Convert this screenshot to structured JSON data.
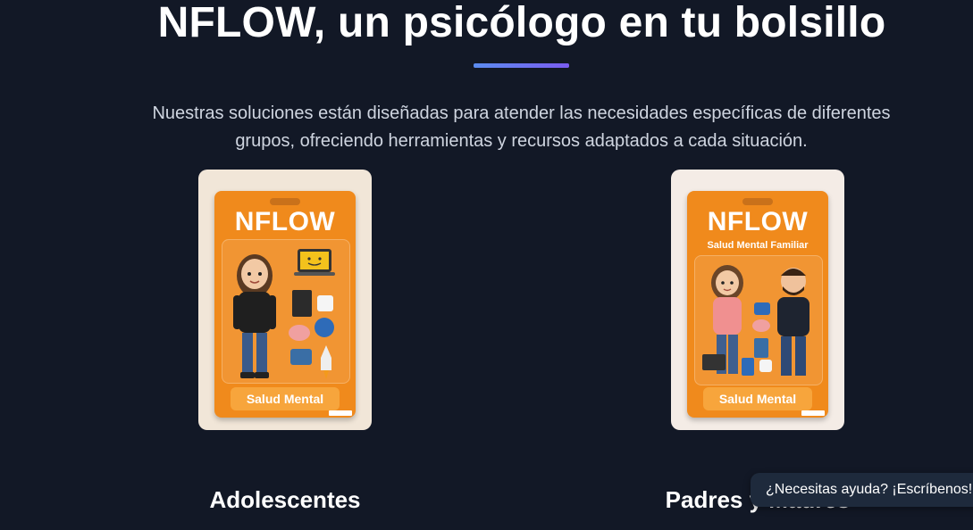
{
  "hero": {
    "title": "NFLOW, un psicólogo en tu bolsillo",
    "subtitle_line1": "Nuestras soluciones están diseñadas para atender las necesidades específicas de diferentes",
    "subtitle_line2": "grupos, ofreciendo herramientas y recursos adaptados a cada situación."
  },
  "cards": [
    {
      "brand": "NFLOW",
      "tagline": "",
      "package_label": "Salud Mental",
      "title": "Adolescentes"
    },
    {
      "brand": "NFLOW",
      "tagline": "Salud Mental Familiar",
      "package_label": "Salud Mental",
      "title": "Padres y Madres"
    }
  ],
  "help_widget": {
    "label": "¿Necesitas ayuda? ¡Escríbenos!"
  },
  "colors": {
    "background": "#121826",
    "accent_start": "#5b8cf0",
    "accent_end": "#7a5cf0",
    "package_orange": "#f08a1c"
  }
}
